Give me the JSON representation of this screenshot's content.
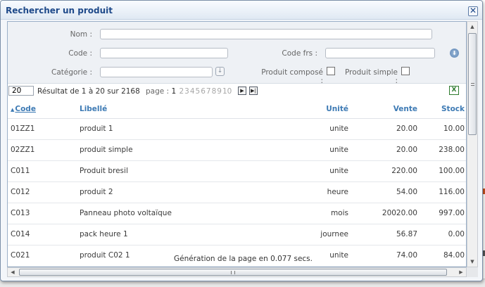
{
  "dialog": {
    "title": "Rechercher un produit",
    "close_symbol": "✕"
  },
  "filters": {
    "nom_label": "Nom :",
    "nom_value": "",
    "code_label": "Code :",
    "code_value": "",
    "code_frs_label": "Code frs :",
    "code_frs_value": "",
    "categorie_label": "Catégorie :",
    "categorie_value": "",
    "produit_compose_label": "Produit composé :",
    "produit_simple_label": "Produit simple :",
    "produit_compose_checked": false,
    "produit_simple_checked": false
  },
  "pager": {
    "per_page": "20",
    "result_text": "Résultat de 1 à 20 sur 2168",
    "page_label": "page :",
    "current_page": "1",
    "other_pages": [
      "2",
      "3",
      "4",
      "5",
      "6",
      "7",
      "8",
      "9",
      "10"
    ],
    "next_symbol": "▶",
    "last_symbol": "▶|"
  },
  "table": {
    "columns": {
      "code": "Code",
      "libelle": "Libellé",
      "unite": "Unité",
      "vente": "Vente",
      "stock": "Stock"
    },
    "sort_symbol": "▲",
    "rows": [
      {
        "code": "01ZZ1",
        "libelle": "produit 1",
        "unite": "unite",
        "vente": "20.00",
        "stock": "10.00"
      },
      {
        "code": "02ZZ1",
        "libelle": "produit simple",
        "unite": "unite",
        "vente": "20.00",
        "stock": "238.00"
      },
      {
        "code": "C011",
        "libelle": "Produit bresil",
        "unite": "unite",
        "vente": "220.00",
        "stock": "100.00"
      },
      {
        "code": "C012",
        "libelle": "produit 2",
        "unite": "heure",
        "vente": "54.00",
        "stock": "116.00"
      },
      {
        "code": "C013",
        "libelle": "Panneau photo voltaïque",
        "unite": "mois",
        "vente": "20020.00",
        "stock": "997.00"
      },
      {
        "code": "C014",
        "libelle": "pack heure 1",
        "unite": "journee",
        "vente": "56.87",
        "stock": "0.00"
      },
      {
        "code": "C021",
        "libelle": "produit C02 1",
        "unite": "unite",
        "vente": "74.00",
        "stock": "84.00"
      }
    ]
  },
  "footer": {
    "generation_text": "Génération de la page en 0.077 secs."
  },
  "icons": {
    "dropdown_arrow": "↓",
    "round_down": "⬇",
    "excel": "X",
    "scroll_up": "▲",
    "scroll_down": "▼",
    "scroll_left": "◀",
    "scroll_right": "▶"
  },
  "colors": {
    "title": "#1f4a8a",
    "header_link": "#3d7ab4",
    "excel_green": "#2d7a2d"
  }
}
